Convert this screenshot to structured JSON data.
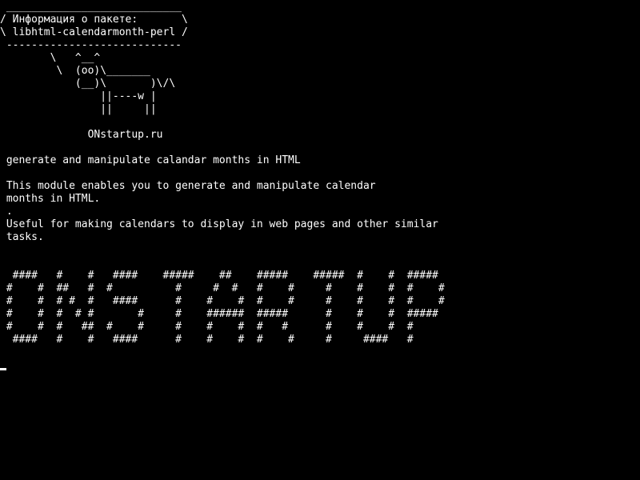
{
  "screen": {
    "cowsay_text": " ____________________________\n/ Информация о пакете:       \\\n\\ libhtml-calendarmonth-perl /\n ----------------------------\n        \\   ^__^\n         \\  (oo)\\_______\n            (__)\\       )\\/\\\n                ||----w |\n                ||     ||",
    "site": "              ONstartup.ru",
    "summary": " generate and manipulate calandar months in HTML",
    "description": " This module enables you to generate and manipulate calendar\n months in HTML.\n .\n Useful for making calendars to display in web pages and other similar\n tasks.",
    "banner_text": "  ####   #    #   ####    #####    ##    #####    #####  #    #  #####\n #    #  ##   #  #          #     #  #   #    #     #    #    #  #    #\n #    #  # #  #   ####      #    #    #  #    #     #    #    #  #    #\n #    #  #  # #       #     #    ######  #####      #    #    #  #####\n #    #  #   ##  #    #     #    #    #  #   #      #    #    #  #\n  ####   #    #   ####      #    #    #  #    #     #     ####   #"
  },
  "colors": {
    "background": "#000000",
    "text": "#ffffff"
  }
}
